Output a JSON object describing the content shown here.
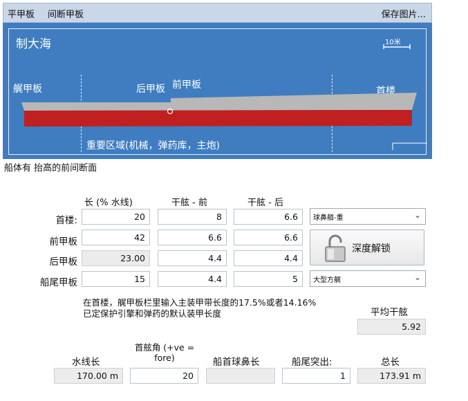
{
  "tabs": {
    "tab1": "平甲板",
    "tab2": "间断甲板",
    "save_pictures": "保存图片..."
  },
  "diagram": {
    "ship_name": "制大海",
    "scale": "10米",
    "labels": {
      "poop": "艉甲板",
      "aft_deck": "后甲板",
      "fore_deck": "前甲板",
      "forecastle": "首楼"
    },
    "citadel": "重要区域(机械，弹药库，主炮)",
    "colors": {
      "panel": "#3f7dc0",
      "hull_upper": "#b8b8b8",
      "hull_lower": "#c0201f"
    }
  },
  "caption": "船体有 抬高的前间断面",
  "columns": {
    "length": "长 (% 水线)",
    "freeboard_fore": "干舷 - 前",
    "freeboard_aft": "干舷 - 后"
  },
  "rows": [
    {
      "label": "首楼:",
      "length": "20",
      "fb_fore": "8",
      "fb_aft": "6.6"
    },
    {
      "label": "前甲板",
      "length": "42",
      "fb_fore": "6.6",
      "fb_aft": "6.6"
    },
    {
      "label": "后甲板",
      "length": "23.00",
      "fb_fore": "4.4",
      "fb_aft": "4.4"
    },
    {
      "label": "船尾甲板",
      "length": "15",
      "fb_fore": "4.4",
      "fb_aft": "5"
    }
  ],
  "bow_select": "球鼻艏-重",
  "stern_select": "大型方艉",
  "unlock_button": "深度解锁",
  "note": "在首楼，艉甲板栏里输入主装甲带长度的17.5%或者14.16% 已定保护引擎和弹药的默认装甲长度",
  "avg_freeboard": {
    "label": "平均干舷",
    "value": "5.92"
  },
  "bottom": {
    "waterline_length": {
      "label": "水线长",
      "value": "170.00 m"
    },
    "bow_angle": {
      "label": "首舷角 (+ve = fore)",
      "value": "20"
    },
    "bulb_length": {
      "label": "船首球鼻长",
      "value": ""
    },
    "stern_overhang": {
      "label": "船尾突出:",
      "value": "1"
    },
    "total_length": {
      "label": "总长",
      "value": "173.91 m"
    }
  }
}
